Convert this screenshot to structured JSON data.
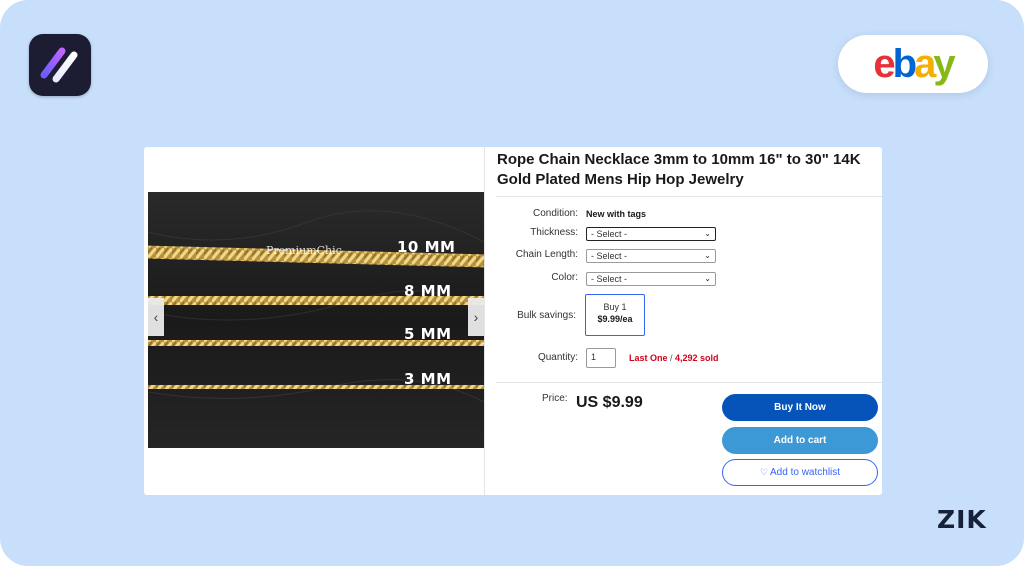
{
  "branding": {
    "marketplace": "ebay",
    "watermark_corner": "ZIK",
    "ebay_colors": [
      "#e53238",
      "#0064d2",
      "#f5af02",
      "#86b817"
    ]
  },
  "listing": {
    "title": "Rope Chain Necklace 3mm to 10mm 16\" to 30\" 14K Gold Plated Mens Hip Hop Jewelry",
    "image": {
      "watermark": "PremiumChic",
      "chain_labels": [
        "10 MM",
        "8 MM",
        "5 MM",
        "3 MM"
      ],
      "prev_icon": "chevron-left-icon",
      "next_icon": "chevron-right-icon"
    },
    "condition": {
      "label": "Condition:",
      "value": "New with tags"
    },
    "thickness": {
      "label": "Thickness:",
      "selected": "- Select -"
    },
    "chain_length": {
      "label": "Chain Length:",
      "selected": "- Select -"
    },
    "color": {
      "label": "Color:",
      "selected": "- Select -"
    },
    "bulk_savings": {
      "label": "Bulk savings:",
      "option_qty": "Buy 1",
      "option_price": "$9.99/ea"
    },
    "quantity": {
      "label": "Quantity:",
      "value": "1",
      "last_one": "Last One",
      "separator": " / ",
      "sold": "4,292 sold"
    },
    "price": {
      "label": "Price:",
      "value": "US $9.99"
    },
    "buttons": {
      "buy_now": "Buy It Now",
      "add_to_cart": "Add to cart",
      "add_to_watchlist": "Add to watchlist"
    }
  }
}
